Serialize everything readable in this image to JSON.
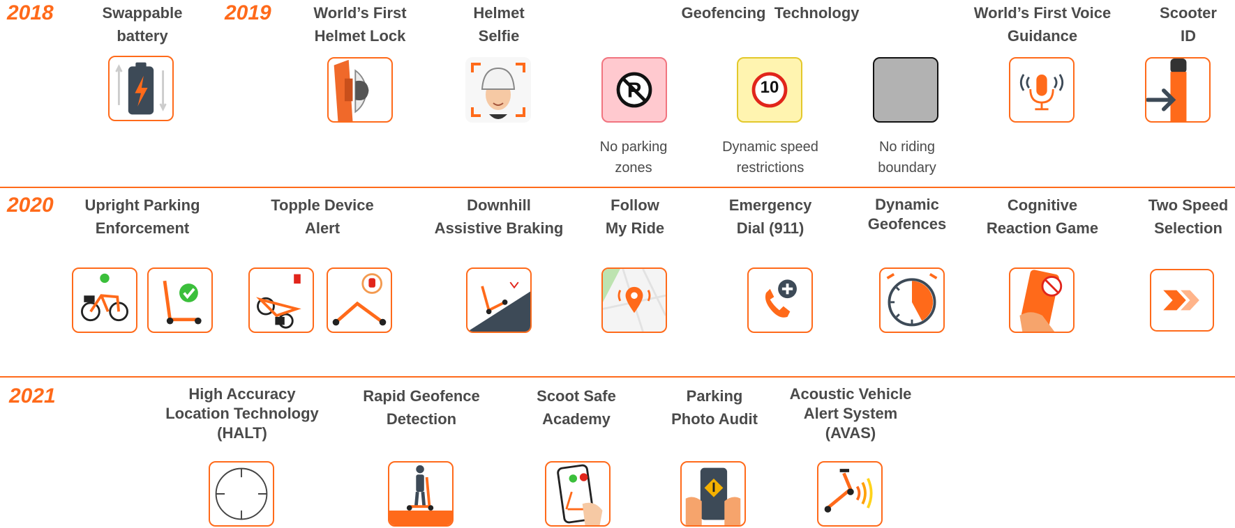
{
  "years": {
    "y2018": "2018",
    "y2019": "2019",
    "y2020": "2020",
    "y2021": "2021"
  },
  "row2018": {
    "swappable_battery": [
      "Swappable",
      "battery"
    ]
  },
  "row2019": {
    "helmet_lock": [
      "World’s First",
      "Helmet Lock"
    ],
    "helmet_selfie": [
      "Helmet",
      "Selfie"
    ],
    "geofencing": "Geofencing  Technology",
    "no_parking": [
      "No parking",
      "zones"
    ],
    "speed_restrictions": [
      "Dynamic speed",
      "restrictions"
    ],
    "speed_value": "10",
    "no_riding": [
      "No riding",
      "boundary"
    ],
    "voice_guidance": [
      "World’s First Voice",
      "Guidance"
    ],
    "scooter_id": [
      "Scooter",
      "ID"
    ]
  },
  "row2020": {
    "upright_parking": [
      "Upright Parking",
      "Enforcement"
    ],
    "topple_alert": [
      "Topple Device",
      "Alert"
    ],
    "downhill_braking": [
      "Downhill",
      "Assistive Braking"
    ],
    "follow_ride": [
      "Follow",
      "My Ride"
    ],
    "emergency_dial": [
      "Emergency",
      "Dial (911)"
    ],
    "dynamic_geofences": [
      "Dynamic",
      "Geofences"
    ],
    "cognitive_game": [
      "Cognitive",
      "Reaction Game"
    ],
    "two_speed": [
      "Two Speed",
      "Selection"
    ]
  },
  "row2021": {
    "halt": [
      "High Accuracy",
      "Location Technology",
      "(HALT)"
    ],
    "rapid_geofence": [
      "Rapid Geofence",
      "Detection"
    ],
    "scoot_safe": [
      "Scoot Safe",
      "Academy"
    ],
    "parking_audit": [
      "Parking",
      "Photo Audit"
    ],
    "avas": [
      "Acoustic Vehicle",
      "Alert System",
      "(AVAS)"
    ]
  },
  "colors": {
    "accent": "#ff6a1a",
    "text": "#4a4a4a",
    "slate": "#3d4a57",
    "gray_zone": "#b2b2b2",
    "pink_zone": "#ffc9cf",
    "yellow_zone": "#fff4b0"
  },
  "icons": [
    "battery-icon",
    "helmet-lock-icon",
    "selfie-icon",
    "no-parking-icon",
    "speed-limit-icon",
    "no-riding-icon",
    "voice-icon",
    "scooter-id-icon",
    "upright-bike-icon",
    "upright-scooter-icon",
    "toppled-bike-icon",
    "toppled-scooter-icon",
    "downhill-icon",
    "map-pin-icon",
    "phone-icon",
    "timer-icon",
    "game-icon",
    "fast-forward-icon",
    "crosshair-icon",
    "geofence-rider-icon",
    "academy-phone-icon",
    "photo-audit-icon",
    "avas-icon"
  ]
}
